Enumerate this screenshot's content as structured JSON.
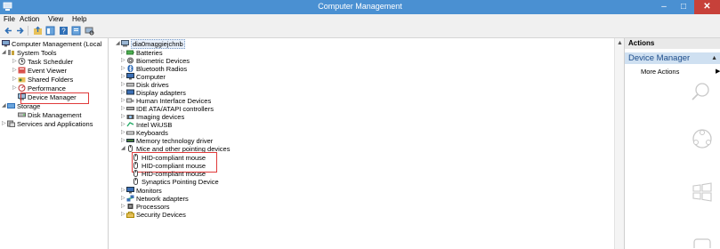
{
  "window": {
    "title": "Computer Management",
    "minimize": "–",
    "maximize": "□",
    "close": "✕"
  },
  "menu": [
    "File",
    "Action",
    "View",
    "Help"
  ],
  "left_tree": [
    {
      "label": "Computer Management (Local",
      "icon": "computer-management-icon"
    },
    {
      "label": "System Tools",
      "icon": "tools-icon"
    },
    {
      "label": "Task Scheduler",
      "icon": "clock-icon"
    },
    {
      "label": "Event Viewer",
      "icon": "event-viewer-icon"
    },
    {
      "label": "Shared Folders",
      "icon": "shared-folder-icon"
    },
    {
      "label": "Performance",
      "icon": "performance-icon"
    },
    {
      "label": "Device Manager",
      "icon": "device-manager-icon"
    },
    {
      "label": "Storage",
      "icon": "storage-icon"
    },
    {
      "label": "Disk Management",
      "icon": "disk-icon"
    },
    {
      "label": "Services and Applications",
      "icon": "services-icon"
    }
  ],
  "device_tree": {
    "root": "dia0maggiejchnb",
    "items": [
      "Batteries",
      "Biometric Devices",
      "Bluetooth Radios",
      "Computer",
      "Disk drives",
      "Display adapters",
      "Human Interface Devices",
      "IDE ATA/ATAPI controllers",
      "Imaging devices",
      "Intel WiUSB",
      "Keyboards",
      "Memory technology driver",
      "Mice and other pointing devices",
      "HID-compliant mouse",
      "HID-compliant mouse",
      "HID-compliant mouse",
      "Synaptics Pointing Device",
      "Monitors",
      "Network adapters",
      "Processors",
      "Security Devices"
    ]
  },
  "actions": {
    "header": "Actions",
    "section": "Device Manager",
    "more": "More Actions"
  },
  "colors": {
    "title_bar": "#4a90d2",
    "close": "#c7413a",
    "highlight": "#e03a3a",
    "section": "#cfe0f1"
  }
}
